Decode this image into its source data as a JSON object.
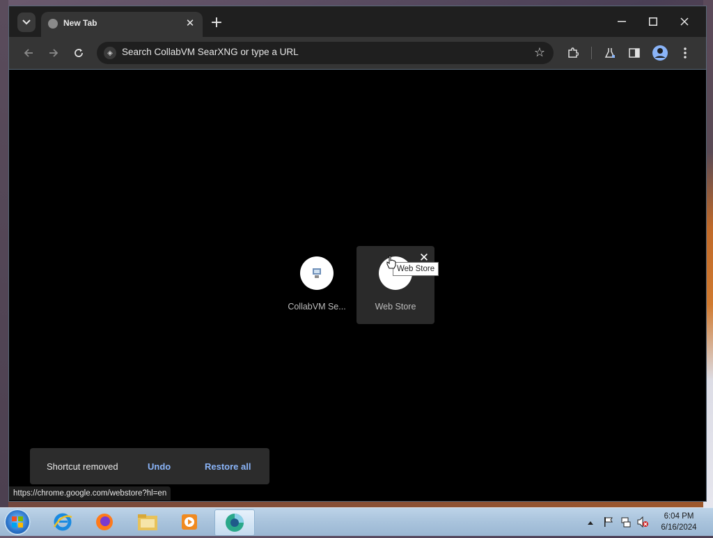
{
  "browser": {
    "tab": {
      "title": "New Tab"
    },
    "omnibox": {
      "placeholder": "Search CollabVM SearXNG or type a URL"
    },
    "status_url": "https://chrome.google.com/webstore?hl=en"
  },
  "shortcuts": [
    {
      "label": "CollabVM Se..."
    },
    {
      "label": "Web Store"
    }
  ],
  "tooltip": "Web Store",
  "toast": {
    "message": "Shortcut removed",
    "undo_label": "Undo",
    "restore_label": "Restore all"
  },
  "taskbar": {
    "time": "6:04 PM",
    "date": "6/16/2024"
  },
  "colors": {
    "accent_link": "#8ab4f8",
    "chrome_dark": "#1f1f1f",
    "toolbar": "#353535"
  }
}
